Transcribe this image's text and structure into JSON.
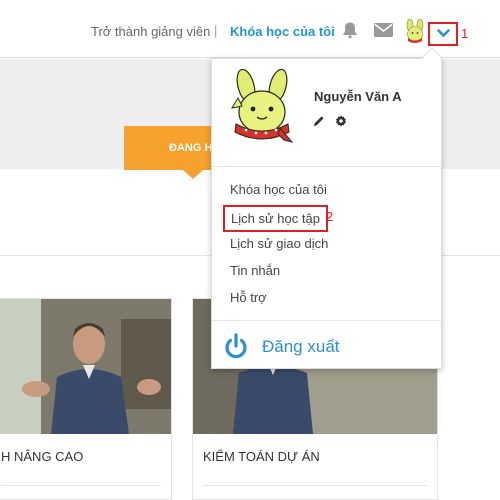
{
  "header": {
    "become_teacher": "Trở thành giảng viên",
    "separator": "|",
    "my_courses": "Khóa học của tôi"
  },
  "banner": {
    "tab_label": "ĐANG H"
  },
  "courses": [
    {
      "title": "H NÂNG CAO"
    },
    {
      "title": "KIỂM TOÁN DỰ ÁN"
    }
  ],
  "user_menu": {
    "user_name": "Nguyễn Văn A",
    "items": [
      {
        "label": "Khóa học của tôi"
      },
      {
        "label": "Lịch sử học tập"
      },
      {
        "label": "Lịch sử giao dịch"
      },
      {
        "label": "Tin nhắn"
      },
      {
        "label": "Hỗ trợ"
      }
    ],
    "logout": "Đăng xuất"
  },
  "annotations": {
    "toggle_marker": "1",
    "history_marker": "2"
  },
  "colors": {
    "accent": "#2196d3",
    "orange": "#f5a12b",
    "highlight": "#e02020"
  }
}
